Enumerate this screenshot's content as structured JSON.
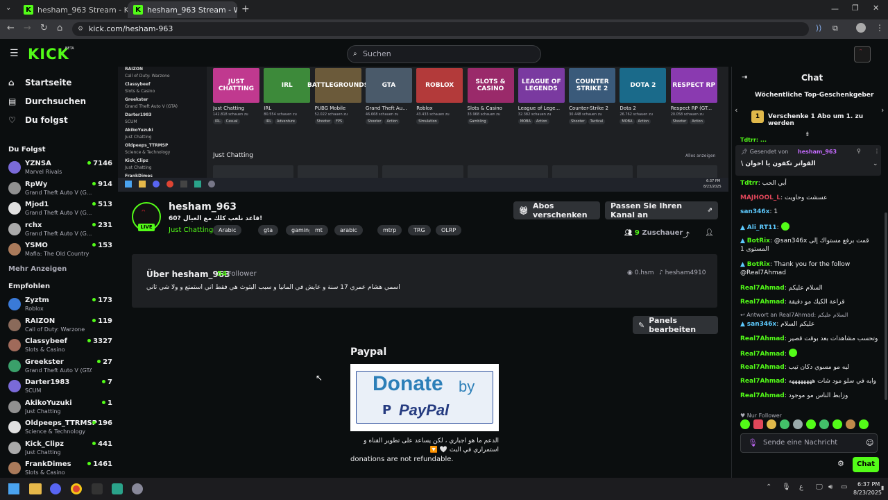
{
  "browser": {
    "tabs": [
      {
        "title": "hesham_963 Stream - Kick Dash"
      },
      {
        "title": "hesham_963 Stream - Watch Li..."
      }
    ],
    "url": "kick.com/hesham-963"
  },
  "header": {
    "logo": "KICK",
    "logo_sup": "BETA",
    "search_placeholder": "Suchen"
  },
  "sidebar": {
    "nav": [
      {
        "label": "Startseite",
        "icon": "home-icon"
      },
      {
        "label": "Durchsuchen",
        "icon": "browse-icon"
      },
      {
        "label": "Du folgst",
        "icon": "heart-icon"
      }
    ],
    "following_title": "Du Folgst",
    "following": [
      {
        "name": "YZNSA",
        "category": "Marvel Rivals",
        "viewers": "7146"
      },
      {
        "name": "RpWy",
        "category": "Grand Theft Auto V (G...",
        "viewers": "914"
      },
      {
        "name": "Mjod1",
        "category": "Grand Theft Auto V (G...",
        "viewers": "513"
      },
      {
        "name": "rchx",
        "category": "Grand Theft Auto V (G...",
        "viewers": "231"
      },
      {
        "name": "YSMO",
        "category": "Mafia: The Old Country",
        "viewers": "153"
      }
    ],
    "more": "Mehr Anzeigen",
    "recommended_title": "Empfohlen",
    "recommended": [
      {
        "name": "Zyztm",
        "category": "Roblox",
        "viewers": "173"
      },
      {
        "name": "RAIZON",
        "category": "Call of Duty: Warzone",
        "viewers": "119"
      },
      {
        "name": "Classybeef",
        "category": "Slots & Casino",
        "viewers": "3327"
      },
      {
        "name": "Greekster",
        "category": "Grand Theft Auto V (GTA)",
        "viewers": "27"
      },
      {
        "name": "Darter1983",
        "category": "SCUM",
        "viewers": "7"
      },
      {
        "name": "AkikoYuzuki",
        "category": "Just Chatting",
        "viewers": "1"
      },
      {
        "name": "Oldpeeps_TTRMSP",
        "category": "Science & Technology",
        "viewers": "196"
      },
      {
        "name": "Kick_Clipz",
        "category": "Just Chatting",
        "viewers": "441"
      },
      {
        "name": "FrankDimes",
        "category": "Slots & Casino",
        "viewers": "1461"
      }
    ]
  },
  "video": {
    "categories": [
      {
        "name": "Just Chatting",
        "viewers": "142.818 schauen zu",
        "tags": [
          "IRL",
          "Casual"
        ],
        "thumb": "JUST CHATTING",
        "color": "#c0398f"
      },
      {
        "name": "IRL",
        "viewers": "80.554 schauen zu",
        "tags": [
          "IRL",
          "Adventure"
        ],
        "thumb": "IRL",
        "color": "#3d8a3a"
      },
      {
        "name": "PUBG Mobile",
        "viewers": "52.022 schauen zu",
        "tags": [
          "Shooter",
          "FPS"
        ],
        "thumb": "BATTLEGROUNDS",
        "color": "#6b5a3a"
      },
      {
        "name": "Grand Theft Au...",
        "viewers": "46.668 schauen zu",
        "tags": [
          "Shooter",
          "Action"
        ],
        "thumb": "GTA",
        "color": "#4a5a6a"
      },
      {
        "name": "Roblox",
        "viewers": "43.433 schauen zu",
        "tags": [
          "Simulation"
        ],
        "thumb": "ROBLOX",
        "color": "#b33a3a"
      },
      {
        "name": "Slots & Casino",
        "viewers": "33.968 schauen zu",
        "tags": [
          "Gambling"
        ],
        "thumb": "SLOTS & CASINO",
        "color": "#9a2a6a"
      },
      {
        "name": "League of Lege...",
        "viewers": "32.382 schauen zu",
        "tags": [
          "MOBA",
          "Action"
        ],
        "thumb": "LEAGUE OF LEGENDS",
        "color": "#7a3aa0"
      },
      {
        "name": "Counter-Strike 2",
        "viewers": "30.448 schauen zu",
        "tags": [
          "Shooter",
          "Tactical"
        ],
        "thumb": "COUNTER STRIKE 2",
        "color": "#3a5a7a"
      },
      {
        "name": "Dota 2",
        "viewers": "26.762 schauen zu",
        "tags": [
          "MOBA",
          "Action"
        ],
        "thumb": "DOTA 2",
        "color": "#1a6a8a"
      },
      {
        "name": "Respect RP (GT...",
        "viewers": "20.058 schauen zu",
        "tags": [
          "Shooter",
          "Action"
        ],
        "thumb": "RESPECT RP",
        "color": "#8a3ab0"
      }
    ],
    "section": "Just Chatting",
    "show_all": "Alles anzeigen",
    "clock": "6:37 PM",
    "date": "8/23/2025"
  },
  "stream": {
    "name": "hesham_963",
    "live": "LIVE",
    "title": "قاعد نلعب كلك مع العيال ?60!",
    "category": "Just Chatting",
    "tags": [
      "Arabic",
      "gta",
      "gaming",
      "mt",
      "arabic",
      "mtrp",
      "TRG",
      "OLRP"
    ],
    "gift_button": "Abos verschenken",
    "customize_button": "Passen Sie Ihren Kanal an",
    "viewers": "9",
    "viewers_label": "Zuschauer"
  },
  "about": {
    "title": "Über hesham_963",
    "followers": "54",
    "followers_label": "Follower",
    "bio": "اسمي هشام عمري 17 سنة و عايش في المانيا و سبب البثوث هي فقط اني استمتع و ولا شي ثاني",
    "social1": "0.hsm",
    "social2": "hesham4910"
  },
  "panels": {
    "edit_button": "Panels bearbeiten",
    "paypal_title": "Paypal",
    "donate": "Donate",
    "by": "by",
    "paypal": "PayPal",
    "text_ar": "الدعم ما هو اجباري ، لكن يساعد على تطوير القناه و استمراري في البث",
    "text_en": "donations are not refundable."
  },
  "chat": {
    "title": "Chat",
    "weekly": "Wöchentliche Top-Geschenkgeber",
    "gift_prompt": "Verschenke 1 Abo um 1. zu werden",
    "pinned_prefix": "Gesendet von",
    "pinned_user": "hesham_963",
    "pinned_text": "القوانر تكفون يا اخوان \\",
    "messages": [
      {
        "user": "Tdtrr",
        "text": "أبي الحب",
        "color": "#53fc18"
      },
      {
        "user": "MAJHOOL_L",
        "text": "عسشت وحاويت",
        "color": "#e0475a"
      },
      {
        "user": "san346x",
        "text": "1",
        "color": "#5ecbff"
      },
      {
        "user": "Ali_RT11",
        "text": "",
        "color": "#5ecbff"
      },
      {
        "user": "BotRix",
        "text": "@san346x قمت برفع مستواك إلى المستوى 1",
        "color": "#53fc18"
      },
      {
        "user": "BotRix",
        "text": "Thank you for the follow @Real7Ahmad",
        "color": "#53fc18"
      },
      {
        "user": "Real7Ahmad",
        "text": "السلام عليكم",
        "color": "#53fc18"
      },
      {
        "user": "Real7Ahmad",
        "text": "قراعة الكيك مو دقيقة",
        "color": "#53fc18"
      },
      {
        "user": "san346x",
        "text": "عليكم السلام",
        "color": "#5ecbff"
      },
      {
        "user": "Real7Ahmad",
        "text": "وتحسب مشاهدات بعد بوقت قصير",
        "color": "#53fc18"
      },
      {
        "user": "Real7Ahmad",
        "text": "",
        "color": "#53fc18"
      },
      {
        "user": "Real7Ahmad",
        "text": "ليه مو مسوي دكان تيب",
        "color": "#53fc18"
      },
      {
        "user": "Real7Ahmad",
        "text": "وايه في سلو مود شات ههههههههه",
        "color": "#53fc18"
      },
      {
        "user": "Real7Ahmad",
        "text": "وزابط الناس مو موجود",
        "color": "#53fc18"
      }
    ],
    "reply_prefix": "Antwort an Real7Ahmad:",
    "reply_quote": "السلام عليكم",
    "nur_follower": "Nur Follower",
    "input_placeholder": "Sende eine Nachricht",
    "send_button": "Chat"
  },
  "taskbar": {
    "time": "6:37 PM",
    "date": "8/23/2025"
  }
}
